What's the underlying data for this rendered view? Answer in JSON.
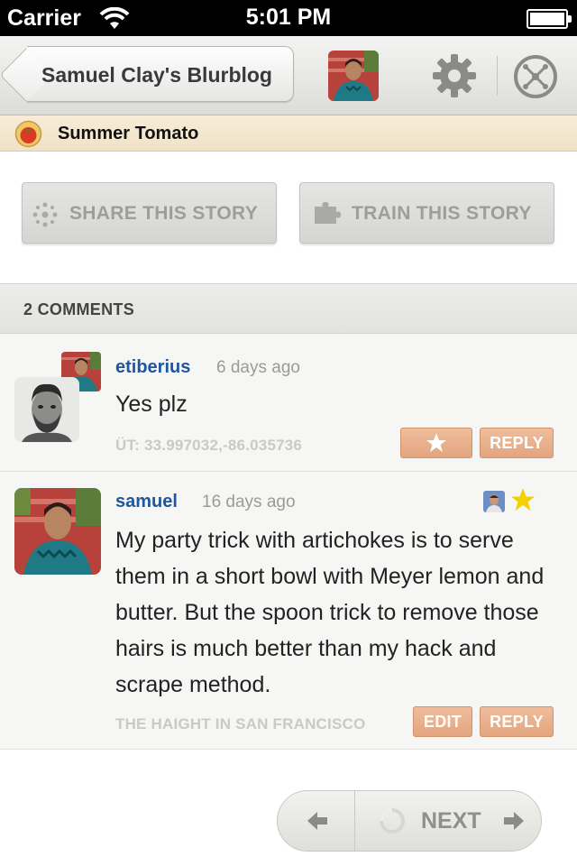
{
  "status_bar": {
    "carrier": "Carrier",
    "time": "5:01 PM"
  },
  "nav": {
    "back_label": "Samuel Clay's Blurblog",
    "icons": [
      "user-avatar",
      "gear-icon",
      "compass-icon"
    ]
  },
  "feed": {
    "title": "Summer Tomato",
    "icon": "tomato-favicon"
  },
  "actions": {
    "share_label": "SHARE THIS STORY",
    "train_label": "TRAIN THIS STORY"
  },
  "comments_header": "2 COMMENTS",
  "comments": [
    {
      "username": "etiberius",
      "time": "6 days ago",
      "text": "Yes plz",
      "location": "ÜT: 33.997032,-86.035736",
      "reply_label": "REPLY"
    },
    {
      "username": "samuel",
      "time": "16 days ago",
      "text": "My party trick with artichokes is to serve them in a short bowl with Meyer lemon and butter. But the spoon trick to remove those hairs is much better than my hack and scrape method.",
      "location": "THE HAIGHT IN SAN FRANCISCO",
      "edit_label": "EDIT",
      "reply_label": "REPLY",
      "starred": true
    }
  ],
  "pager": {
    "next_label": "NEXT"
  },
  "colors": {
    "username": "#1f56a0",
    "button_orange": "#e3a57f",
    "feed_bar": "#f7ecd7",
    "star": "#f4d000"
  }
}
